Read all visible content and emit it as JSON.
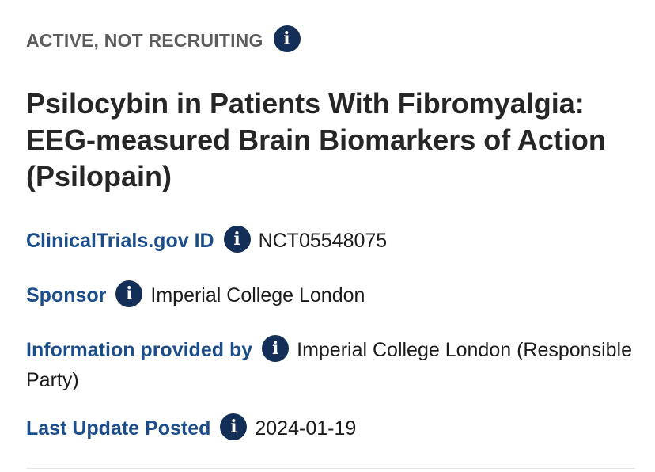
{
  "status": {
    "label": "ACTIVE, NOT RECRUITING"
  },
  "study": {
    "title": "Psilocybin in Patients With Fibromyalgia: EEG-measured Brain Biomarkers of Action (Psilopain)"
  },
  "details": {
    "id_label": "ClinicalTrials.gov ID",
    "id_value": "NCT05548075",
    "sponsor_label": "Sponsor",
    "sponsor_value": "Imperial College London",
    "provided_label": "Information provided by",
    "provided_value": "Imperial College London (Responsible Party)",
    "updated_label": "Last Update Posted",
    "updated_value": "2024-01-19"
  },
  "icons": {
    "info_glyph": "i",
    "info_icon_name": "info-icon",
    "info_color": "#132e57"
  },
  "colors": {
    "label": "#1b4d8a",
    "status": "#5c5c5c",
    "title": "#262626"
  }
}
